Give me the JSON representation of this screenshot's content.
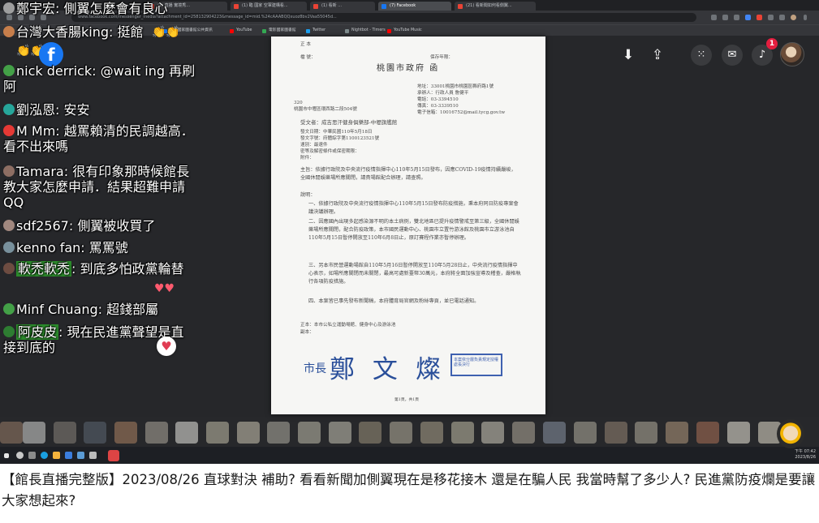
{
  "browser": {
    "tabs": [
      {
        "label": "(1) 直播 實境秀...",
        "color": "#ea4335"
      },
      {
        "label": "(1) 臨 國家 空軍建構看...",
        "color": "#ea4335"
      },
      {
        "label": "(1) 看新 ...",
        "color": "#ea4335"
      },
      {
        "label": "(7) Facebook",
        "color": "#1877f2"
      },
      {
        "label": "(21) 看新聞如何看側翼...",
        "color": "#ea4335"
      }
    ],
    "url": "www.facebook.com/messenger_media?attachment_id=258132904223&message_id=mid.%24cAAABQQxuoz8bv2Vaa55045d..."
  },
  "bookmarks": [
    {
      "label": "臺灣國家圖書館公共資訊",
      "color": "#1a73e8"
    },
    {
      "label": "YouTube",
      "color": "#ff0000"
    },
    {
      "label": "電影國家圖書館",
      "color": "#34a853"
    },
    {
      "label": "Twitter",
      "color": "#1da1f2"
    },
    {
      "label": "Nightbot - Timers",
      "color": "#7f8c8d"
    },
    {
      "label": "YouTube Music",
      "color": "#ff0000"
    }
  ],
  "viewer": {
    "icons": {
      "download": "download-icon",
      "share": "share-icon",
      "menu": "grid-menu-icon",
      "messenger": "messenger-icon",
      "bell": "bell-icon"
    },
    "notification_count": "1"
  },
  "document": {
    "header": "正 本",
    "archive": "檔 號：",
    "retention": "保存年限：",
    "agency_title": "桃園市政府 函",
    "address_lines": [
      "地址：33001桃園市桃園區縣府路1號",
      "承辦人：行政人員 詹健平",
      "電話：03-3394510",
      "傳真：03-3339510",
      "電子信箱：10016752@mail.tycg.gov.tw"
    ],
    "postcode": "320",
    "recipient_addr": "桃園市中壢區環西路二段504號",
    "recipient": "受文者：成吉思汗健身俱樂部-中壢旗艦館",
    "meta": [
      "發文日期：中華民國110年5月18日",
      "發文字號：府體綜字第1100123521號",
      "速別：最速件",
      "密等及解密條件或保密期限：",
      "附件："
    ],
    "subject": "主旨：依據行政院及中央流行疫情指揮中心110年5月15日發布，因應COVID-19疫情持續嚴峻，全國休閒娛樂場所應關閉，請貴場館配合辦理，請查照。",
    "explanation_label": "說明：",
    "items": [
      "一、依據行政院及中央流行疫情指揮中心110年5月15日發布防疫措施，秉本府同日防疫專案會議決議辦理。",
      "二、因應國內出現多起感染源不明的本土病例，雙北地區已提升疫情警戒至第三級，全國休閒娛樂場所應關閉，配合防疫政策，本市國民運動中心、桃園市立置竹游泳館及桃園市立游泳池自110年5月15日暫停開放至110年6月8日止，原訂賽程作業亦暫停辦理。",
      "三、另本市民營運動場館自110年5月16日暫停開放至110年5月28日止，中央流行疫情指揮中心表示，如場所應關閉而未關閉，最高可處新臺幣30萬元，本府將全面加強宣導及稽查，嚴格執行各項防疫措施。",
      "四、本案皆已事先發布新聞稿，本府體育局官網及粉絲專頁，並已電話通知。"
    ],
    "cc": "正本：本市公私立運動場館、健身中心及游泳池",
    "cc2": "副本：",
    "sign_prefix": "市長",
    "signature": "鄭 文 燦",
    "stamp_text": "本案依分層負責規定授權處長決行",
    "page": "第1頁，共1頁"
  },
  "chat": [
    {
      "name": "鄭宇宏",
      "text": "側翼怎麼會有良心",
      "color": "#9e9e9e"
    },
    {
      "name": "台灣大香腸king",
      "text": "挺館",
      "color": "#c77e4b"
    },
    {
      "name": "nick derrick",
      "text": "@wait ing 再刷阿",
      "color": "#43a047"
    },
    {
      "name": "劉泓恩",
      "text": "安安",
      "color": "#26a69a"
    },
    {
      "name": "M Mm",
      "text": "越罵賴清的民調越高．看不出來嗎",
      "color": "#e53935"
    },
    {
      "name": "Tamara",
      "text": "很有印象那時候館長教大家怎麼申請．結果超難申請QQ",
      "color": "#8d6e63"
    },
    {
      "name": "sdf2567",
      "text": "側翼被收買了",
      "color": "#a1887f"
    },
    {
      "name": "kenno fan",
      "text": "罵罵號",
      "color": "#78909c"
    },
    {
      "name": "軟禿軟禿",
      "text": "到底多怕政黨輪替",
      "color": "#6d4c41"
    },
    {
      "name": "Minf Chuang",
      "text": "超錢部屬",
      "color": "#43a047"
    },
    {
      "name": "阿皮皮",
      "text": "現在民進黨聲望是直接到底的",
      "color": "#2e7d32"
    }
  ],
  "taskbar": {
    "time": "下午 07:42",
    "date": "2023/8/26"
  },
  "caption": "【館長直播完整版】2023/08/26 直球對決 補助? 看看新聞加側翼現在是移花接木 還是在騙人民 我當時幫了多少人? 民進黨防疫爛是要讓大家想起來?"
}
